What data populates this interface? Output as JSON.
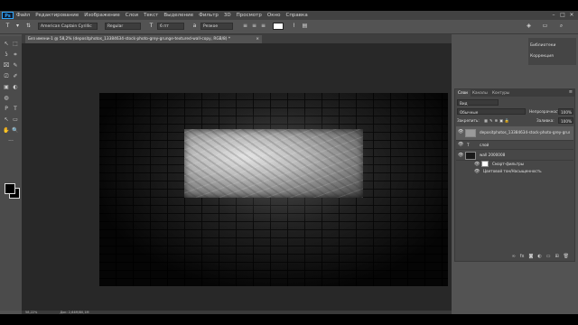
{
  "menubar": {
    "logo": "Ps",
    "items": [
      "Файл",
      "Редактирование",
      "Изображение",
      "Слои",
      "Текст",
      "Выделение",
      "Фильтр",
      "3D",
      "Просмотр",
      "Окно",
      "Справка"
    ],
    "window_controls": [
      "–",
      "□",
      "✕"
    ]
  },
  "options_bar": {
    "tool_icon": "T",
    "font_family": "American Captain Cyrillic",
    "font_style": "Regular",
    "font_size": "6 пт",
    "antialias": "Резкое",
    "color_swatch": "#ffffff"
  },
  "document_tab": {
    "title": "Без имени-1 @ 58,2% (depositphotos_13384634-stock-photo-grey-grunge-textured-wall-copy, RGB/8) *",
    "close": "×"
  },
  "tools": [
    "↖",
    "⬚",
    "ʖ",
    "⌗",
    "⌧",
    "✎",
    "⎚",
    "✐",
    "▣",
    "◐",
    "◍",
    "P",
    "T",
    "↖",
    "▭",
    "✋",
    "🔍",
    "···"
  ],
  "colors": {
    "foreground": "#000000",
    "background": "#000000",
    "accent": "#31a8ff"
  },
  "mini_dock": {
    "items": [
      "Библиотеки",
      "Коррекция"
    ]
  },
  "layers_panel": {
    "tabs": [
      "Слои",
      "Каналы",
      "Контуры"
    ],
    "filter_label": "Вид",
    "blend_mode": "Обычные",
    "opacity_label": "Непрозрачность:",
    "opacity_value": "100%",
    "lock_label": "Закрепить:",
    "fill_label": "Заливка:",
    "fill_value": "100%",
    "layers": [
      {
        "name": "depositphotos_13384634-stock-photo-grey-grung...",
        "type": "smart",
        "selected": true
      },
      {
        "name": "слой",
        "type": "text",
        "selected": false
      },
      {
        "name": "wall 2000008",
        "type": "image",
        "selected": false
      }
    ],
    "sub_items": [
      "Смарт-фильтры",
      "Цветовой тон/Насыщенность"
    ],
    "footer_icons": [
      "link-icon",
      "fx-icon",
      "mask-icon",
      "adjustment-icon",
      "group-icon",
      "new-layer-icon",
      "trash-icon"
    ]
  },
  "status_bar": {
    "zoom": "58,22%",
    "doc": "Док: 2,64М/80,1М"
  }
}
